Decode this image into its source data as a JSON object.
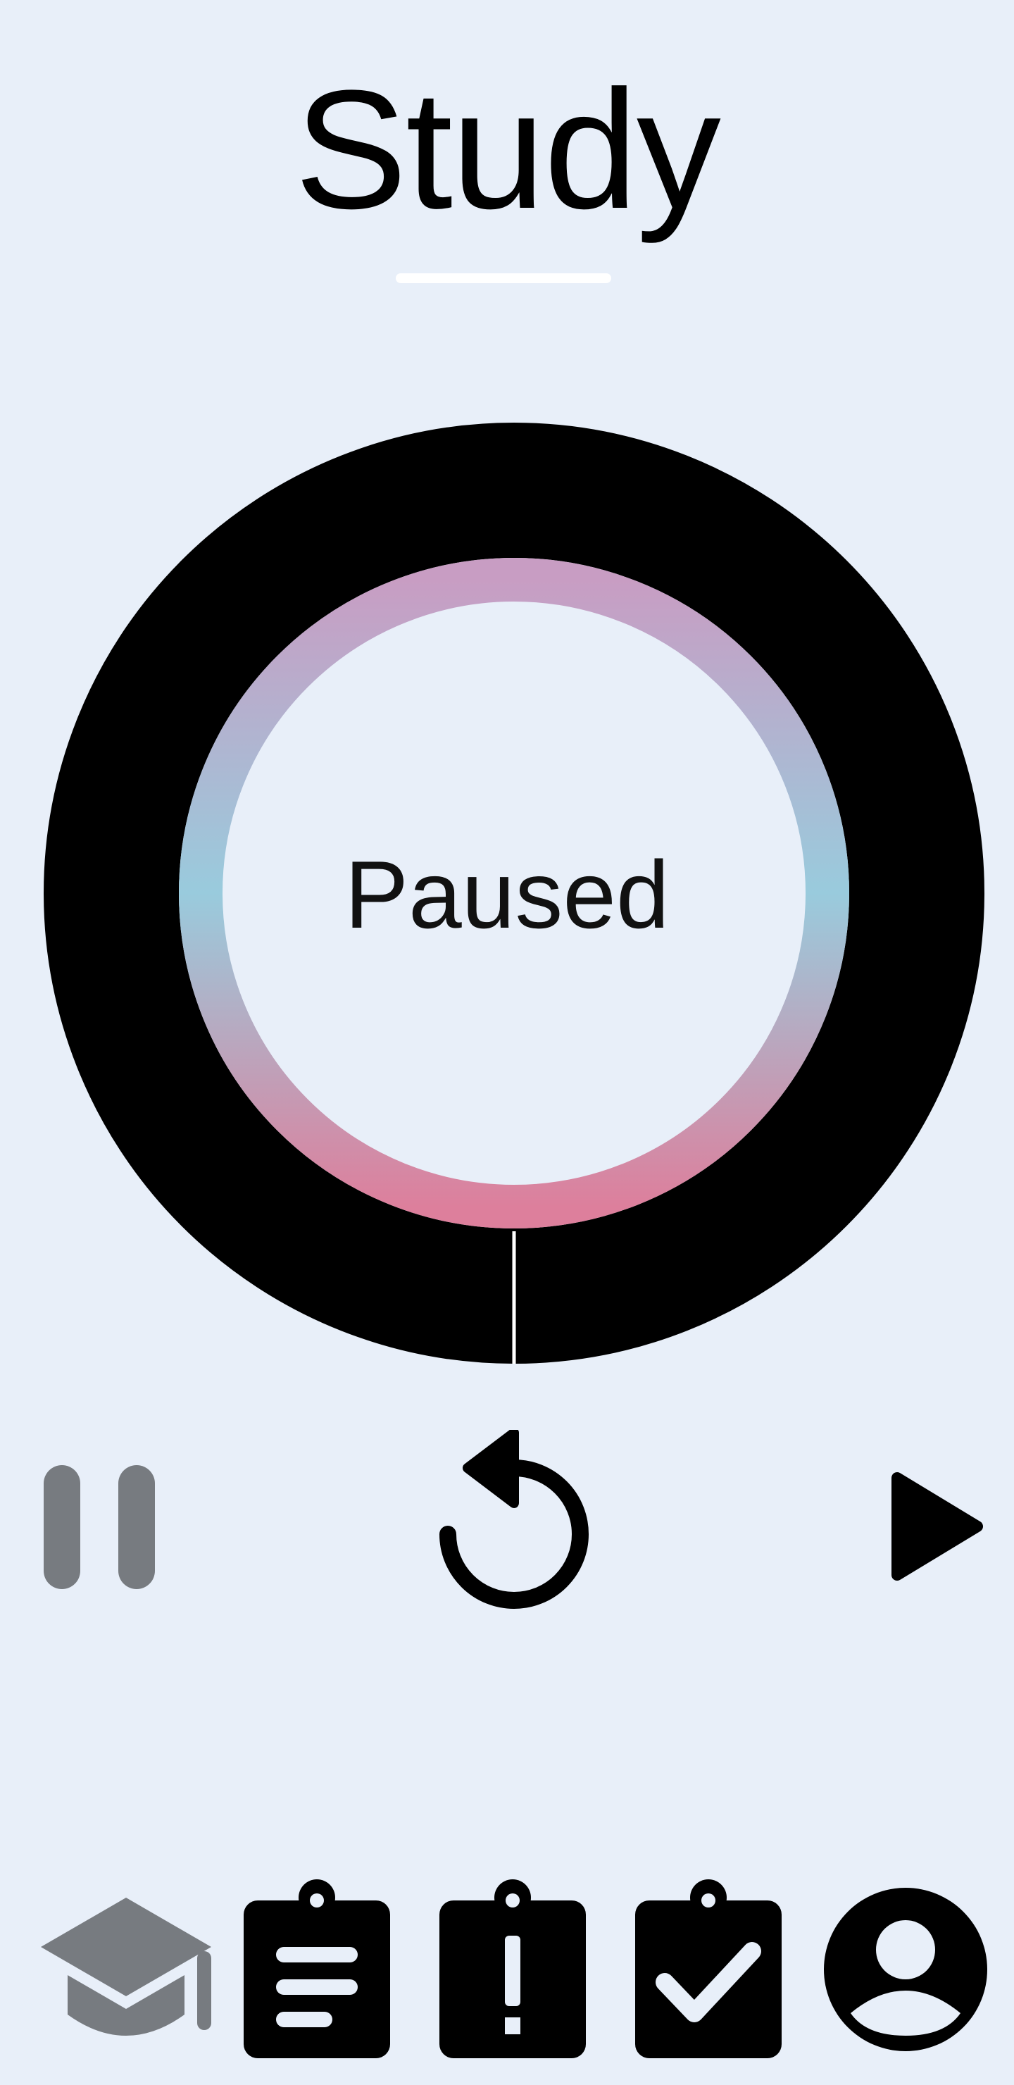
{
  "header": {
    "title": "Study"
  },
  "timer": {
    "status": "Paused",
    "progress_fraction": 1.0
  },
  "controls": {
    "pause_icon": "pause-icon",
    "reset_icon": "reset-icon",
    "play_icon": "play-icon"
  },
  "bottom_nav": {
    "items": [
      {
        "icon": "graduation-cap-icon",
        "active": true
      },
      {
        "icon": "clipboard-list-icon",
        "active": false
      },
      {
        "icon": "clipboard-alert-icon",
        "active": false
      },
      {
        "icon": "clipboard-check-icon",
        "active": false
      },
      {
        "icon": "account-circle-icon",
        "active": false
      }
    ]
  },
  "colors": {
    "background": "#e8eff9",
    "active_icon": "#777b80",
    "inactive_icon": "#000000",
    "ring_outer": "#000000",
    "ring_gradient_top": "#c89dc3",
    "ring_gradient_side": "#99cbdd",
    "ring_gradient_bottom": "#dd7f9c"
  }
}
